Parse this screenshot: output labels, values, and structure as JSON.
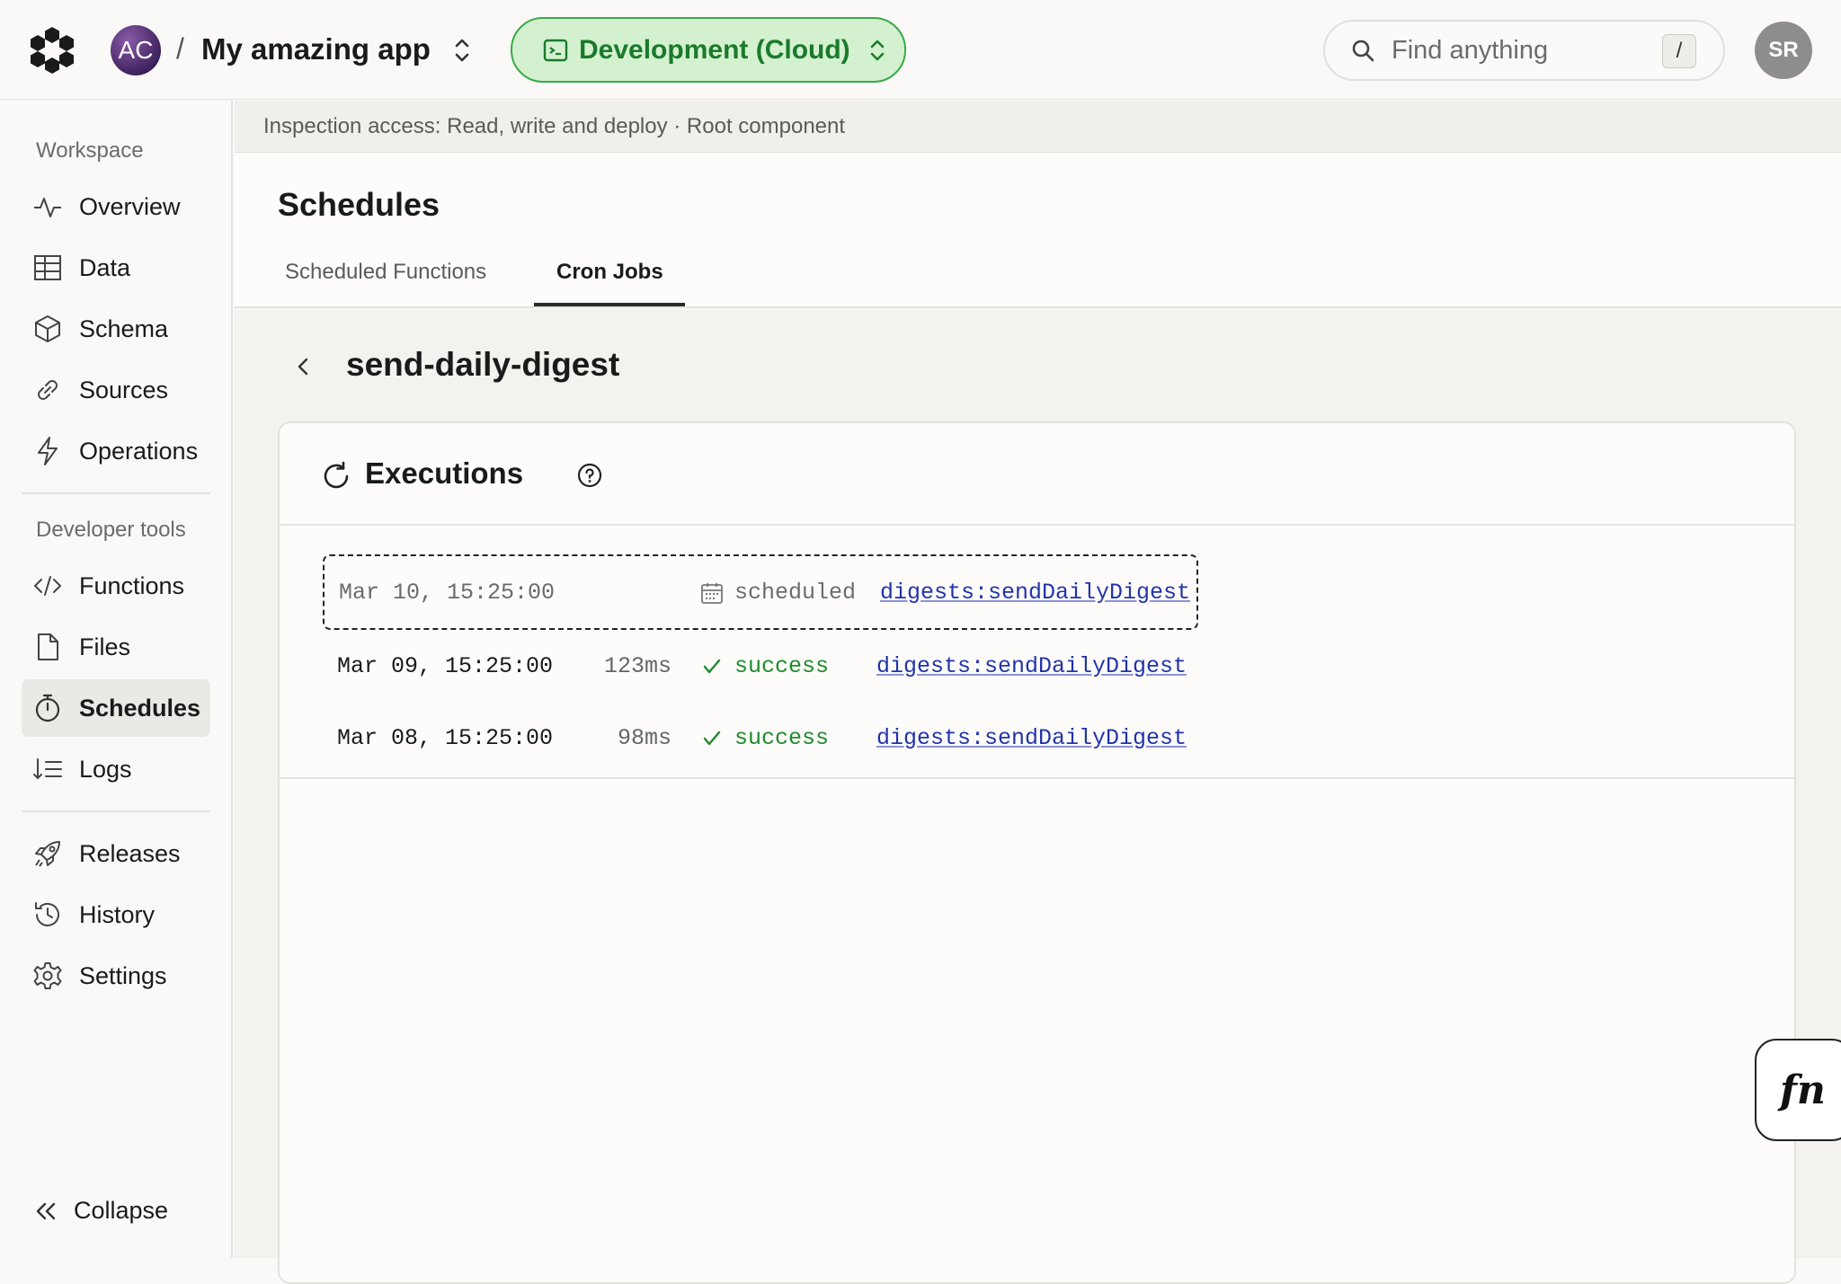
{
  "header": {
    "team_initials": "AC",
    "separator": "/",
    "project_name": "My amazing app",
    "deployment_label": "Development (Cloud)",
    "search_placeholder": "Find anything",
    "search_shortcut": "/",
    "user_initials": "SR"
  },
  "sidebar": {
    "workspace_label": "Workspace",
    "workspace_items": [
      {
        "label": "Overview",
        "icon": "pulse-icon"
      },
      {
        "label": "Data",
        "icon": "table-icon"
      },
      {
        "label": "Schema",
        "icon": "cube-icon"
      },
      {
        "label": "Sources",
        "icon": "link-icon"
      },
      {
        "label": "Operations",
        "icon": "bolt-icon"
      }
    ],
    "devtools_label": "Developer tools",
    "devtools_items": [
      {
        "label": "Functions",
        "icon": "code-icon"
      },
      {
        "label": "Files",
        "icon": "file-icon"
      },
      {
        "label": "Schedules",
        "icon": "stopwatch-icon",
        "active": true
      },
      {
        "label": "Logs",
        "icon": "sort-list-icon"
      }
    ],
    "other_items": [
      {
        "label": "Releases",
        "icon": "rocket-icon"
      },
      {
        "label": "History",
        "icon": "history-icon"
      },
      {
        "label": "Settings",
        "icon": "gear-icon"
      }
    ],
    "collapse_label": "Collapse"
  },
  "access_bar": {
    "text": "Inspection access: Read, write and deploy · Root component"
  },
  "page": {
    "title": "Schedules",
    "tabs": [
      {
        "label": "Scheduled Functions",
        "active": false
      },
      {
        "label": "Cron Jobs",
        "active": true
      }
    ]
  },
  "job": {
    "name": "send-daily-digest",
    "executions_title": "Executions",
    "executions": [
      {
        "time": "Mar 10, 15:25:00",
        "duration": "",
        "status": "scheduled",
        "function": "digests:sendDailyDigest"
      },
      {
        "time": "Mar 09, 15:25:00",
        "duration": "123ms",
        "status": "success",
        "function": "digests:sendDailyDigest"
      },
      {
        "time": "Mar 08, 15:25:00",
        "duration": "98ms",
        "status": "success",
        "function": "digests:sendDailyDigest"
      }
    ]
  },
  "fn_button": {
    "label": "fn"
  },
  "colors": {
    "deploy_green_bg": "#d3f1cf",
    "deploy_green_text": "#1a7a2c",
    "success_green": "#1e8a2c",
    "link_blue": "#2233aa"
  }
}
